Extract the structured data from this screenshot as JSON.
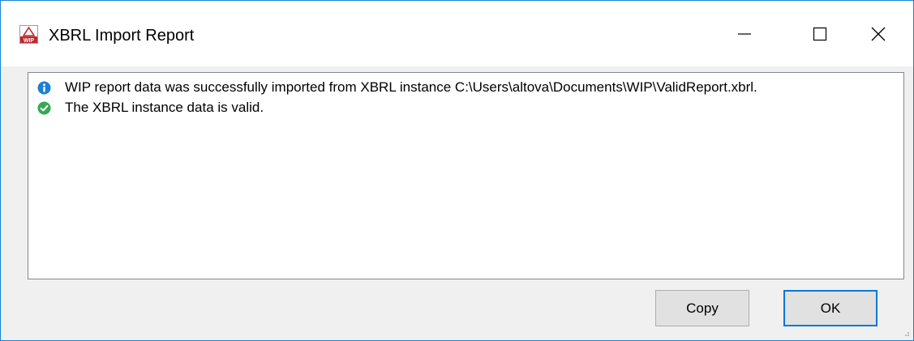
{
  "window": {
    "title": "XBRL Import Report",
    "app_icon": "wip-app-icon",
    "controls": {
      "minimize_icon": "minimize-icon",
      "maximize_icon": "maximize-icon",
      "close_icon": "close-icon"
    },
    "accent_color": "#1883d7"
  },
  "log": {
    "messages": [
      {
        "icon": "info-icon",
        "icon_color": "#1e7fd6",
        "text": "WIP report data was successfully imported from XBRL instance C:\\Users\\altova\\Documents\\WIP\\ValidReport.xbrl."
      },
      {
        "icon": "check-circle-icon",
        "icon_color": "#35a853",
        "text": "The XBRL instance data is valid."
      }
    ]
  },
  "buttons": {
    "copy_label": "Copy",
    "ok_label": "OK"
  }
}
